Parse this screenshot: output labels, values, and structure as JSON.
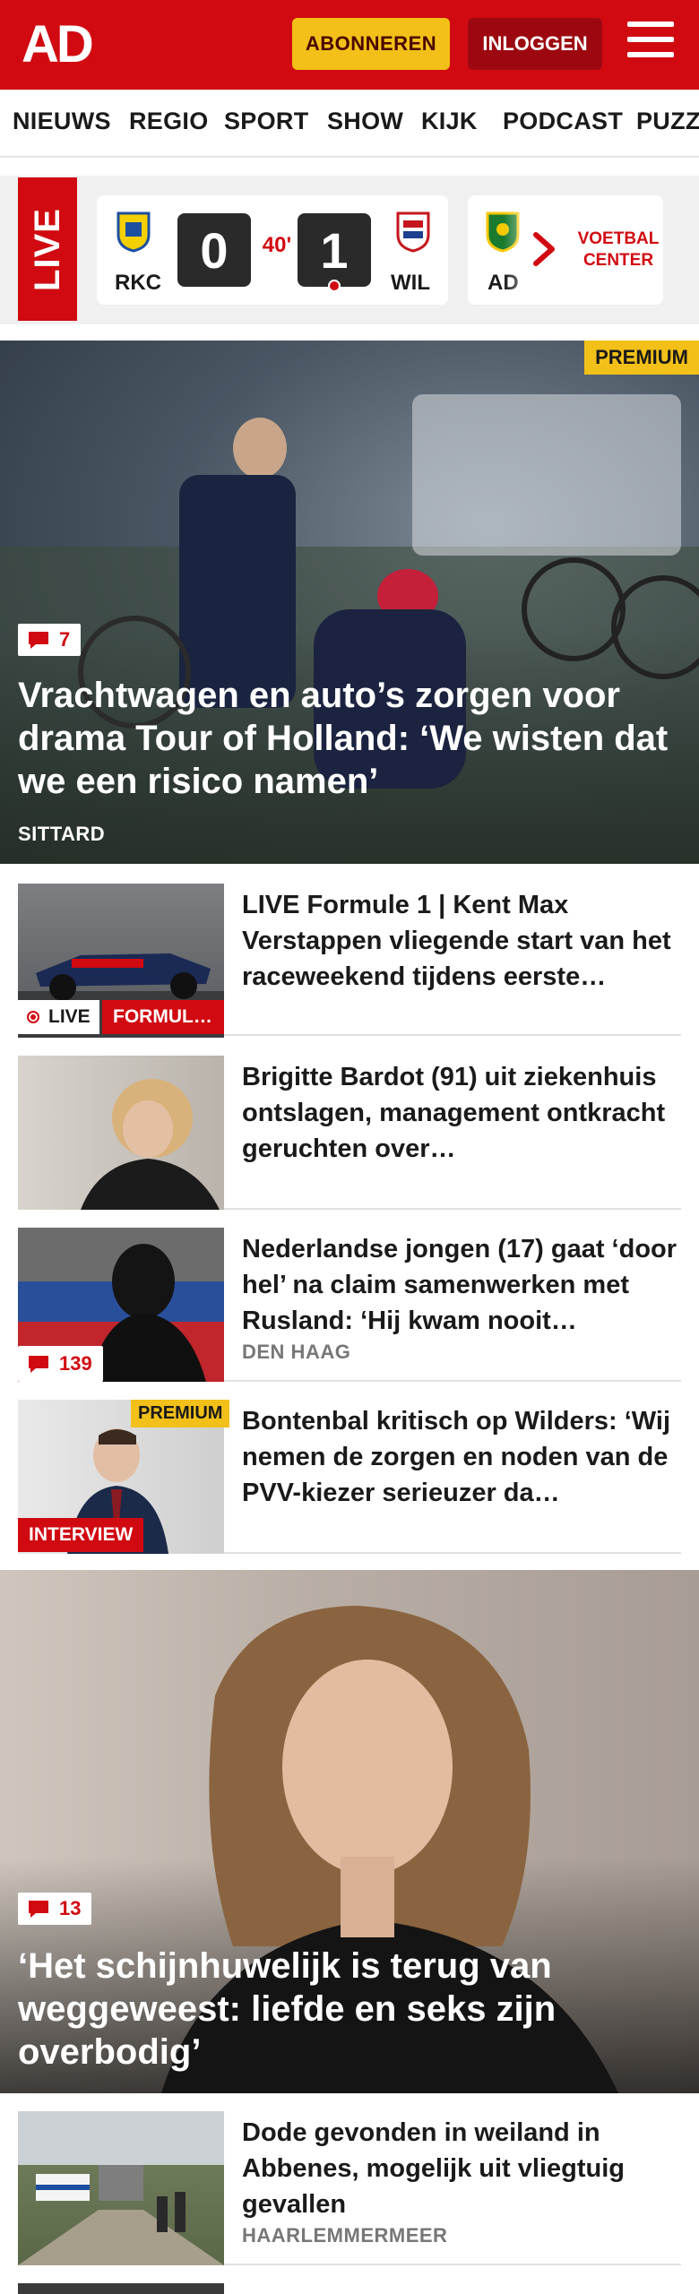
{
  "header": {
    "logo": "AD",
    "subscribe_label": "ABONNEREN",
    "login_label": "INLOGGEN"
  },
  "nav": {
    "items": [
      "NIEUWS",
      "REGIO",
      "SPORT",
      "SHOW",
      "KIJK",
      "PODCAST",
      "PUZZ"
    ]
  },
  "live": {
    "tag": "LIVE",
    "match": {
      "home": "RKC",
      "away": "WIL",
      "home_score": "0",
      "away_score": "1",
      "minute": "40'"
    },
    "next_match_team": "AD",
    "voetbal_center": "VOETBAL CENTER"
  },
  "hero1": {
    "premium": "PREMIUM",
    "comments": "7",
    "title": "Vrachtwagen en auto’s zorgen voor drama Tour of Holland: ‘We wisten dat we een risico namen’",
    "location": "SITTARD"
  },
  "articles": [
    {
      "title": "LIVE Formule 1 | Kent Max Verstappen vliegende start van het raceweekend tijdens eerste…",
      "live": "LIVE",
      "category": "FORMUL…"
    },
    {
      "title": "Brigitte Bardot (91) uit ziekenhuis ontslagen, management ontkracht geruchten over…"
    },
    {
      "title": "Nederlandse jongen (17) gaat ‘door hel’ na claim samenwerken met Rusland: ‘Hij kwam nooit…",
      "location": "DEN HAAG",
      "comments": "139"
    },
    {
      "title": "Bontenbal kritisch op Wilders: ‘Wij nemen de zorgen en noden van de PVV-kiezer serieuzer da…",
      "premium": "PREMIUM",
      "category": "INTERVIEW"
    }
  ],
  "hero2": {
    "comments": "13",
    "title": "‘Het schijnhuwelijk is terug van weggeweest: liefde en seks zijn overbodig’"
  },
  "articles2": [
    {
      "title": "Dode gevonden in weiland in Abbenes, mogelijk uit vliegtuig gevallen",
      "location": "HAARLEMMERMEER"
    }
  ],
  "colors": {
    "brand_red": "#d10a11",
    "premium_yellow": "#f2c018"
  }
}
